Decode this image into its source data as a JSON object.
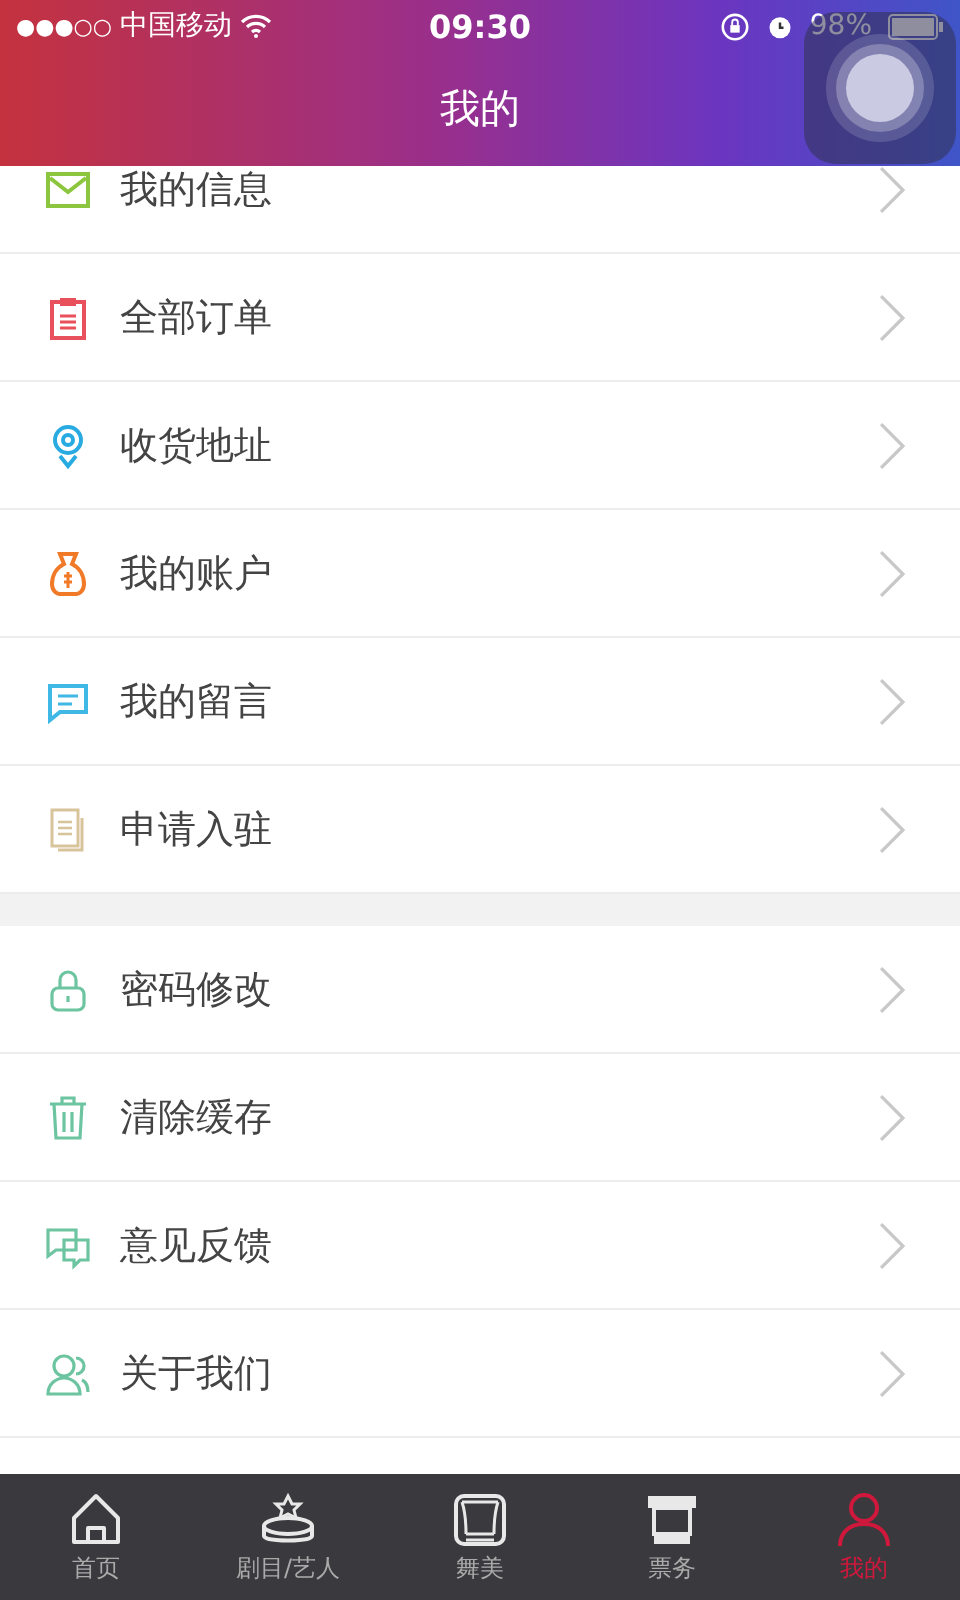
{
  "status_bar": {
    "signal_dots": "●●●○○",
    "carrier": "中国移动",
    "time": "09:30",
    "battery": "98%"
  },
  "header": {
    "title": "我的"
  },
  "sections": [
    {
      "items": [
        {
          "label": "我的信息"
        },
        {
          "label": "全部订单"
        },
        {
          "label": "收货地址"
        },
        {
          "label": "我的账户"
        },
        {
          "label": "我的留言"
        },
        {
          "label": "申请入驻"
        }
      ]
    },
    {
      "items": [
        {
          "label": "密码修改"
        },
        {
          "label": "清除缓存"
        },
        {
          "label": "意见反馈"
        },
        {
          "label": "关于我们"
        }
      ]
    }
  ],
  "tab_bar": [
    {
      "label": "首页",
      "selected": false
    },
    {
      "label": "剧目/艺人",
      "selected": false
    },
    {
      "label": "舞美",
      "selected": false
    },
    {
      "label": "票务",
      "selected": false
    },
    {
      "label": "我的",
      "selected": true
    }
  ]
}
